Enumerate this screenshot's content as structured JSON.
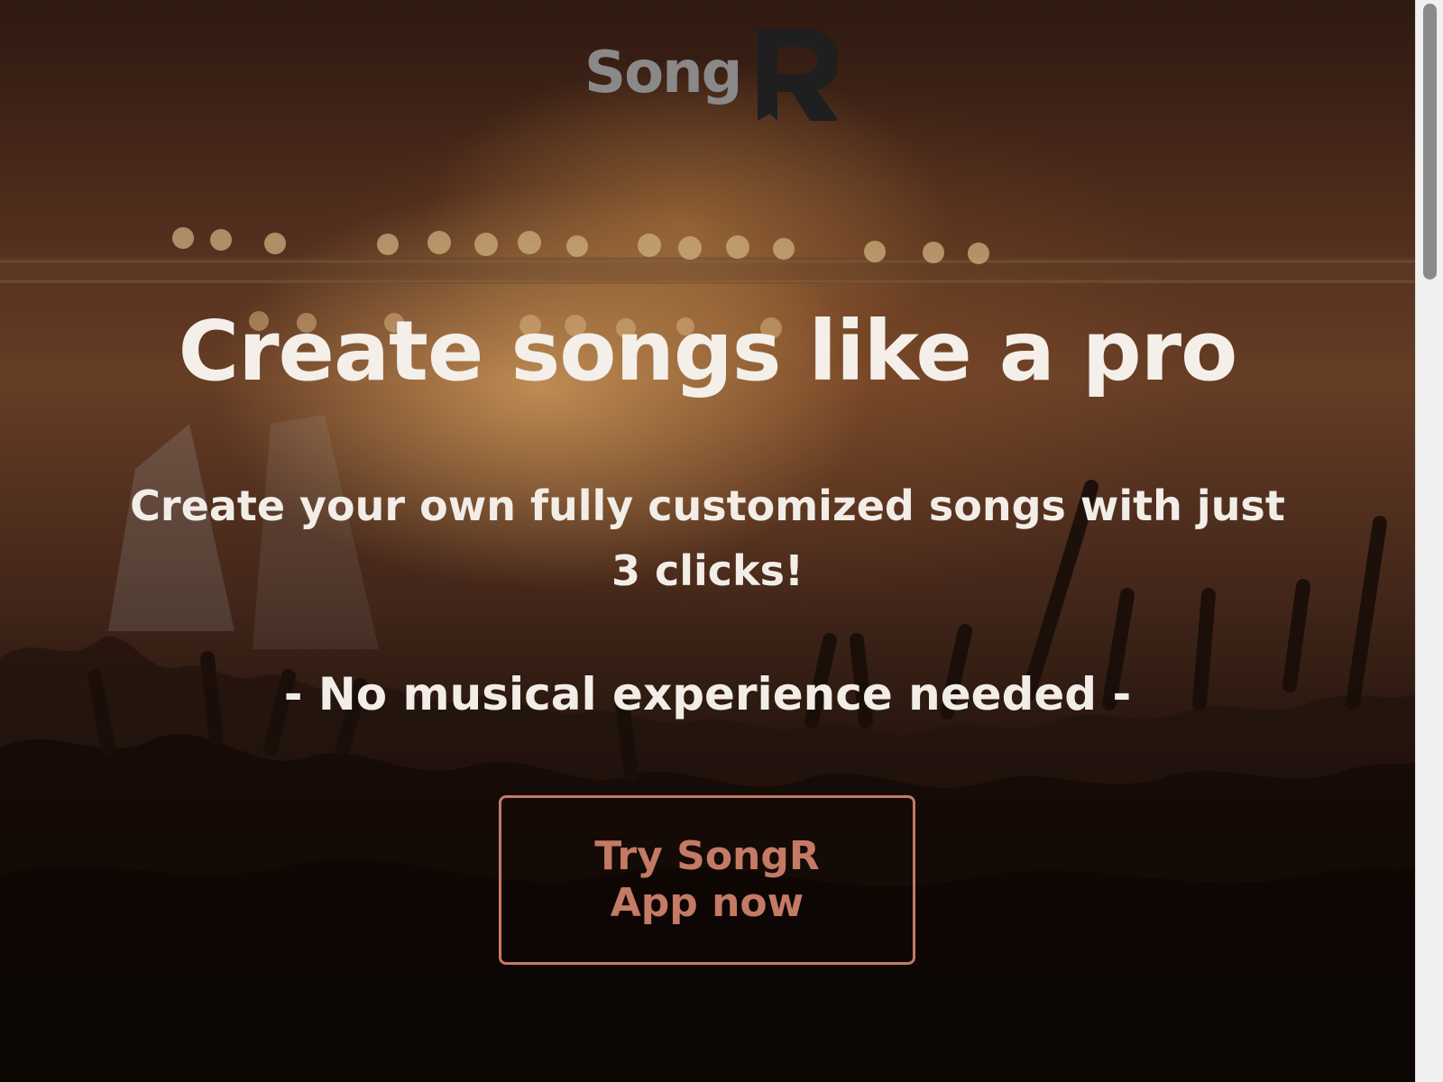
{
  "logo": {
    "text_part": "Song",
    "mark_part": "R",
    "text_color": "#8a8888",
    "mark_color": "#1f1f1f"
  },
  "hero": {
    "headline": "Create songs like a pro",
    "subheadline": "Create your own fully customized songs with just 3 clicks!",
    "tagline": "- No musical experience needed -",
    "background": "concert-crowd-photo"
  },
  "cta": {
    "label": "Try SongR App now",
    "accent_color": "#c47a64"
  },
  "scrollbar": {
    "thumb_color": "#8a8a8a",
    "track_color": "#f0f0f0"
  }
}
